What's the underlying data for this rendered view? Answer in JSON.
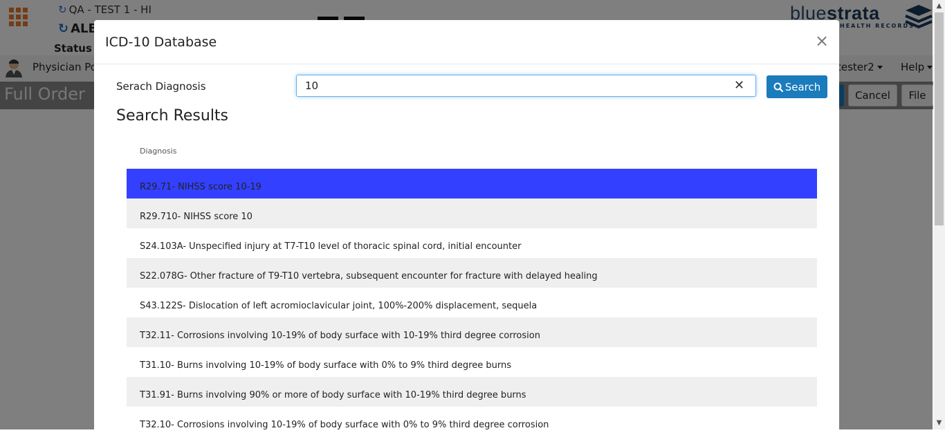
{
  "app": {
    "context_line1": "QA - TEST 1 - HI",
    "context_line2": "ALB",
    "status_label": "Status :",
    "logo_light": "blue",
    "logo_bold": "strata",
    "logo_sub": "HEALTH RECORDS",
    "nav_physician": "Physician Po",
    "nav_user": "tester2",
    "nav_help": "Help",
    "page_title": "Full Order",
    "btn_cancel": "Cancel",
    "btn_file": "File"
  },
  "modal": {
    "title": "ICD-10 Database",
    "close_glyph": "×",
    "search_label": "Serach Diagnosis",
    "search_value": "10",
    "clear_glyph": "✕",
    "search_button": "Search",
    "results_title": "Search Results",
    "column_header": "Diagnosis",
    "results": [
      "R29.71- NIHSS score 10-19",
      "R29.710- NIHSS score 10",
      "S24.103A- Unspecified injury at T7-T10 level of thoracic spinal cord, initial encounter",
      "S22.078G- Other fracture of T9-T10 vertebra, subsequent encounter for fracture with delayed healing",
      "S43.122S- Dislocation of left acromioclavicular joint, 100%-200% displacement, sequela",
      "T32.11- Corrosions involving 10-19% of body surface with 10-19% third degree corrosion",
      "T31.10- Burns involving 10-19% of body surface with 0% to 9% third degree burns",
      "T31.91- Burns involving 90% or more of body surface with 10-19% third degree burns",
      "T32.10- Corrosions involving 10-19% of body surface with 0% to 9% third degree corrosion"
    ],
    "selected_index": 0
  },
  "colors": {
    "accent": "#1a7bbd",
    "selected_row": "#3340ff",
    "alt_row": "#efefef",
    "apps_icon": "#e8762c"
  },
  "icons": [
    "apps-grid-icon",
    "refresh-icon",
    "avatar-icon",
    "close-icon",
    "clear-icon",
    "search-icon",
    "caret-down-icon"
  ]
}
